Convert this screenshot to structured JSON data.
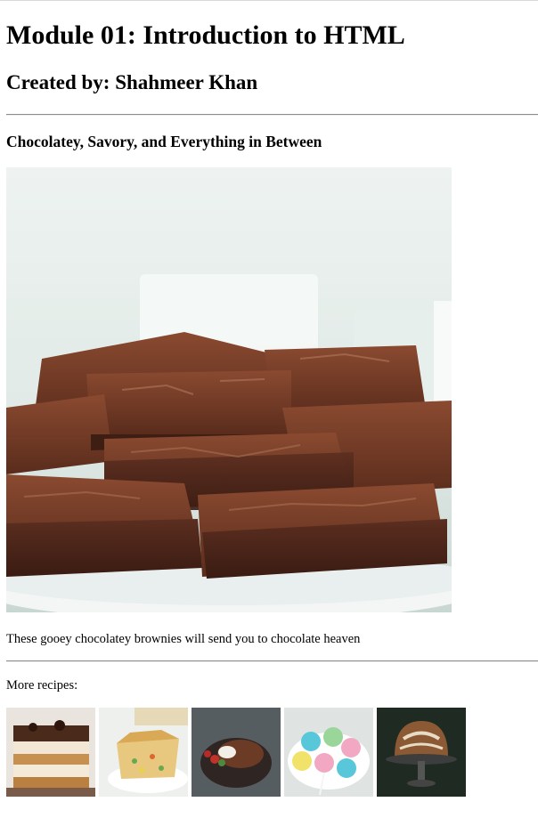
{
  "page": {
    "title": "Module 01: Introduction to HTML",
    "author": "Created by: Shahmeer Khan",
    "section_heading": "Chocolatey, Savory, and Everything in Between",
    "caption": "These gooey chocolatey brownies will send you to chocolate heaven",
    "more_label": "More recipes:"
  },
  "hero_image": {
    "icon": "brownies-photo"
  },
  "thumbnails": [
    {
      "icon": "tiramisu-photo"
    },
    {
      "icon": "pot-pie-photo"
    },
    {
      "icon": "lava-cake-photo"
    },
    {
      "icon": "cake-pops-photo"
    },
    {
      "icon": "bundt-cake-photo"
    }
  ]
}
